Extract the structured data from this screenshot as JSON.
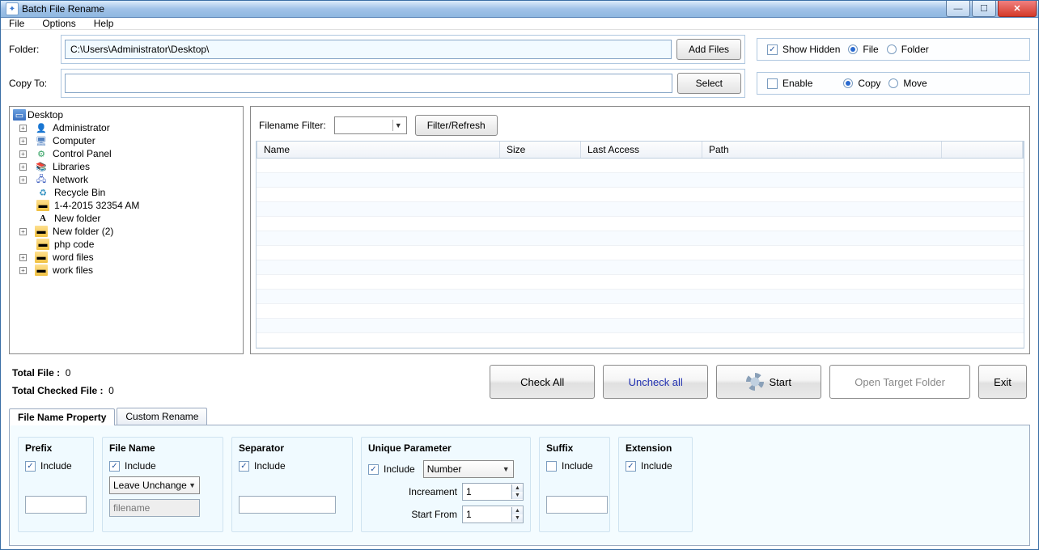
{
  "title": "Batch File Rename",
  "menu": {
    "file": "File",
    "options": "Options",
    "help": "Help"
  },
  "folder": {
    "label": "Folder:",
    "path": "C:\\Users\\Administrator\\Desktop\\",
    "add_files": "Add Files"
  },
  "copy": {
    "label": "Copy To:",
    "path": "",
    "select": "Select"
  },
  "view": {
    "show_hidden": "Show Hidden",
    "show_hidden_checked": true,
    "file": "File",
    "folder": "Folder",
    "file_selected": true,
    "enable": "Enable",
    "enable_checked": false,
    "copy_opt": "Copy",
    "move_opt": "Move",
    "copy_selected": true
  },
  "tree": {
    "root": "Desktop",
    "items": [
      {
        "exp": true,
        "icon": "user",
        "label": "Administrator"
      },
      {
        "exp": true,
        "icon": "computer",
        "label": "Computer"
      },
      {
        "exp": true,
        "icon": "cpl",
        "label": "Control Panel"
      },
      {
        "exp": true,
        "icon": "lib",
        "label": "Libraries"
      },
      {
        "exp": true,
        "icon": "net",
        "label": "Network"
      },
      {
        "exp": false,
        "icon": "recycle",
        "label": "Recycle Bin"
      },
      {
        "exp": false,
        "icon": "folder",
        "label": "1-4-2015 32354 AM"
      },
      {
        "exp": false,
        "icon": "A",
        "label": "New folder"
      },
      {
        "exp": true,
        "icon": "folder",
        "label": "New folder (2)"
      },
      {
        "exp": false,
        "icon": "folder",
        "label": "php code"
      },
      {
        "exp": true,
        "icon": "folder",
        "label": "word files"
      },
      {
        "exp": true,
        "icon": "folder",
        "label": "work files"
      }
    ]
  },
  "filter": {
    "label": "Filename Filter:",
    "button": "Filter/Refresh"
  },
  "columns": {
    "c1": "Name",
    "c2": "Size",
    "c3": "Last Access",
    "c4": "Path"
  },
  "stats": {
    "total_label": "Total File :",
    "total_value": "0",
    "checked_label": "Total Checked File :",
    "checked_value": "0"
  },
  "actions": {
    "check_all": "Check All",
    "uncheck_all": "Uncheck all",
    "start": "Start",
    "open_target": "Open Target Folder",
    "exit": "Exit"
  },
  "tabs": {
    "t1": "File Name Property",
    "t2": "Custom Rename"
  },
  "groups": {
    "prefix": {
      "title": "Prefix",
      "include": "Include",
      "checked": true,
      "value": ""
    },
    "filename": {
      "title": "File Name",
      "include": "Include",
      "checked": true,
      "mode": "Leave Unchange",
      "placeholder": "filename"
    },
    "separator": {
      "title": "Separator",
      "include": "Include",
      "checked": true,
      "value": ""
    },
    "unique": {
      "title": "Unique Parameter",
      "include": "Include",
      "checked": true,
      "type": "Number",
      "inc_label": "Increament",
      "inc": "1",
      "start_label": "Start From",
      "start": "1"
    },
    "suffix": {
      "title": "Suffix",
      "include": "Include",
      "checked": false,
      "value": ""
    },
    "extension": {
      "title": "Extension",
      "include": "Include",
      "checked": true
    }
  }
}
